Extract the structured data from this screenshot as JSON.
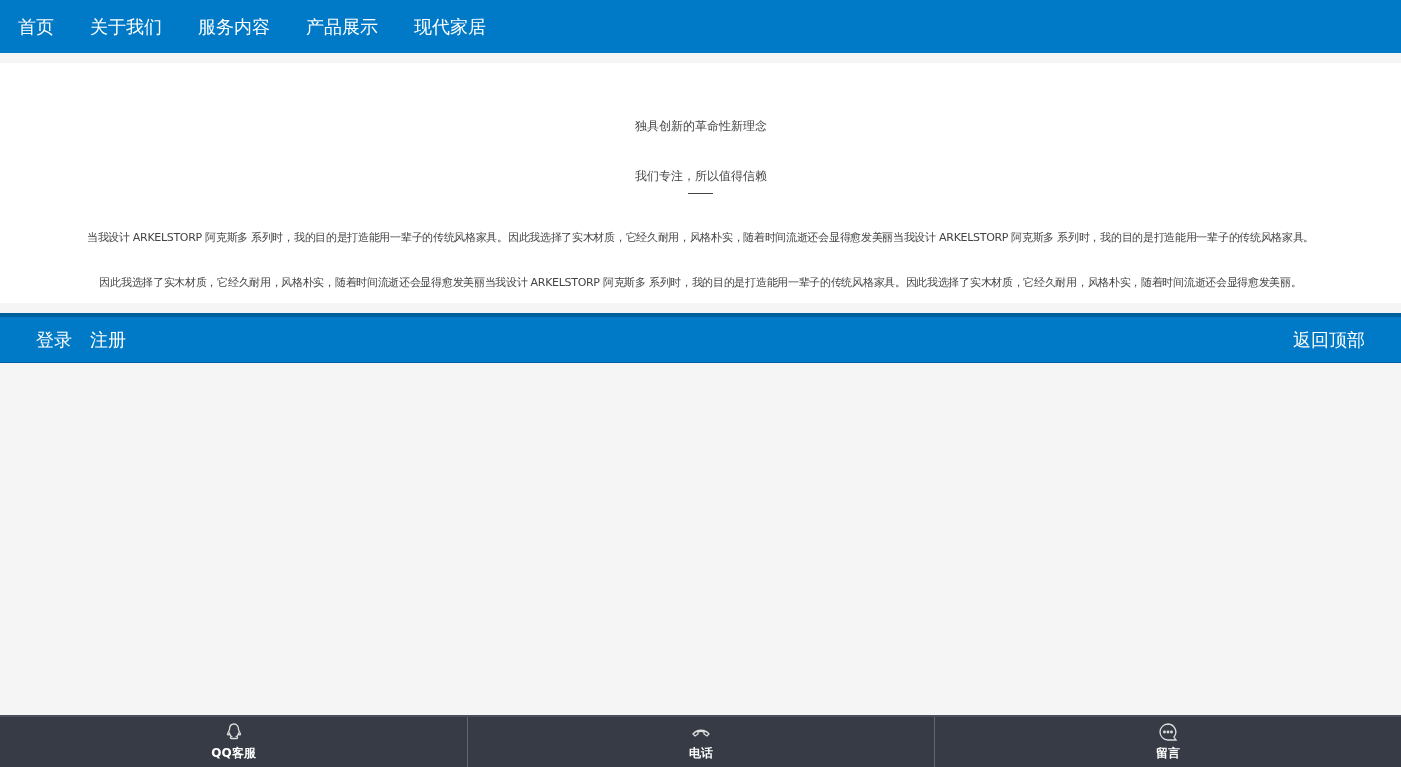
{
  "nav": {
    "items": [
      "首页",
      "关于我们",
      "服务内容",
      "产品展示",
      "现代家居"
    ]
  },
  "intro": {
    "title": "独具创新的革命性新理念",
    "subtitle": "我们专注，所以值得信赖",
    "paragraphs": [
      "当我设计 ARKELSTORP 阿克斯多 系列时，我的目的是打造能用一辈子的传统风格家具。因此我选择了实木材质，它经久耐用，风格朴实，随着时间流逝还会显得愈发美丽当我设计 ARKELSTORP 阿克斯多 系列时，我的目的是打造能用一辈子的传统风格家具。",
      "因此我选择了实木材质，它经久耐用，风格朴实，随着时间流逝还会显得愈发美丽当我设计 ARKELSTORP 阿克斯多 系列时，我的目的是打造能用一辈子的传统风格家具。因此我选择了实木材质，它经久耐用，风格朴实，随着时间流逝还会显得愈发美丽。"
    ]
  },
  "footer": {
    "links": [
      "登录",
      "注册"
    ],
    "back_to_top": "返回顶部"
  },
  "bottom_bar": [
    {
      "kind": "qq",
      "label": "QQ客服"
    },
    {
      "kind": "phone",
      "label": "电话"
    },
    {
      "kind": "message",
      "label": "留言"
    }
  ]
}
